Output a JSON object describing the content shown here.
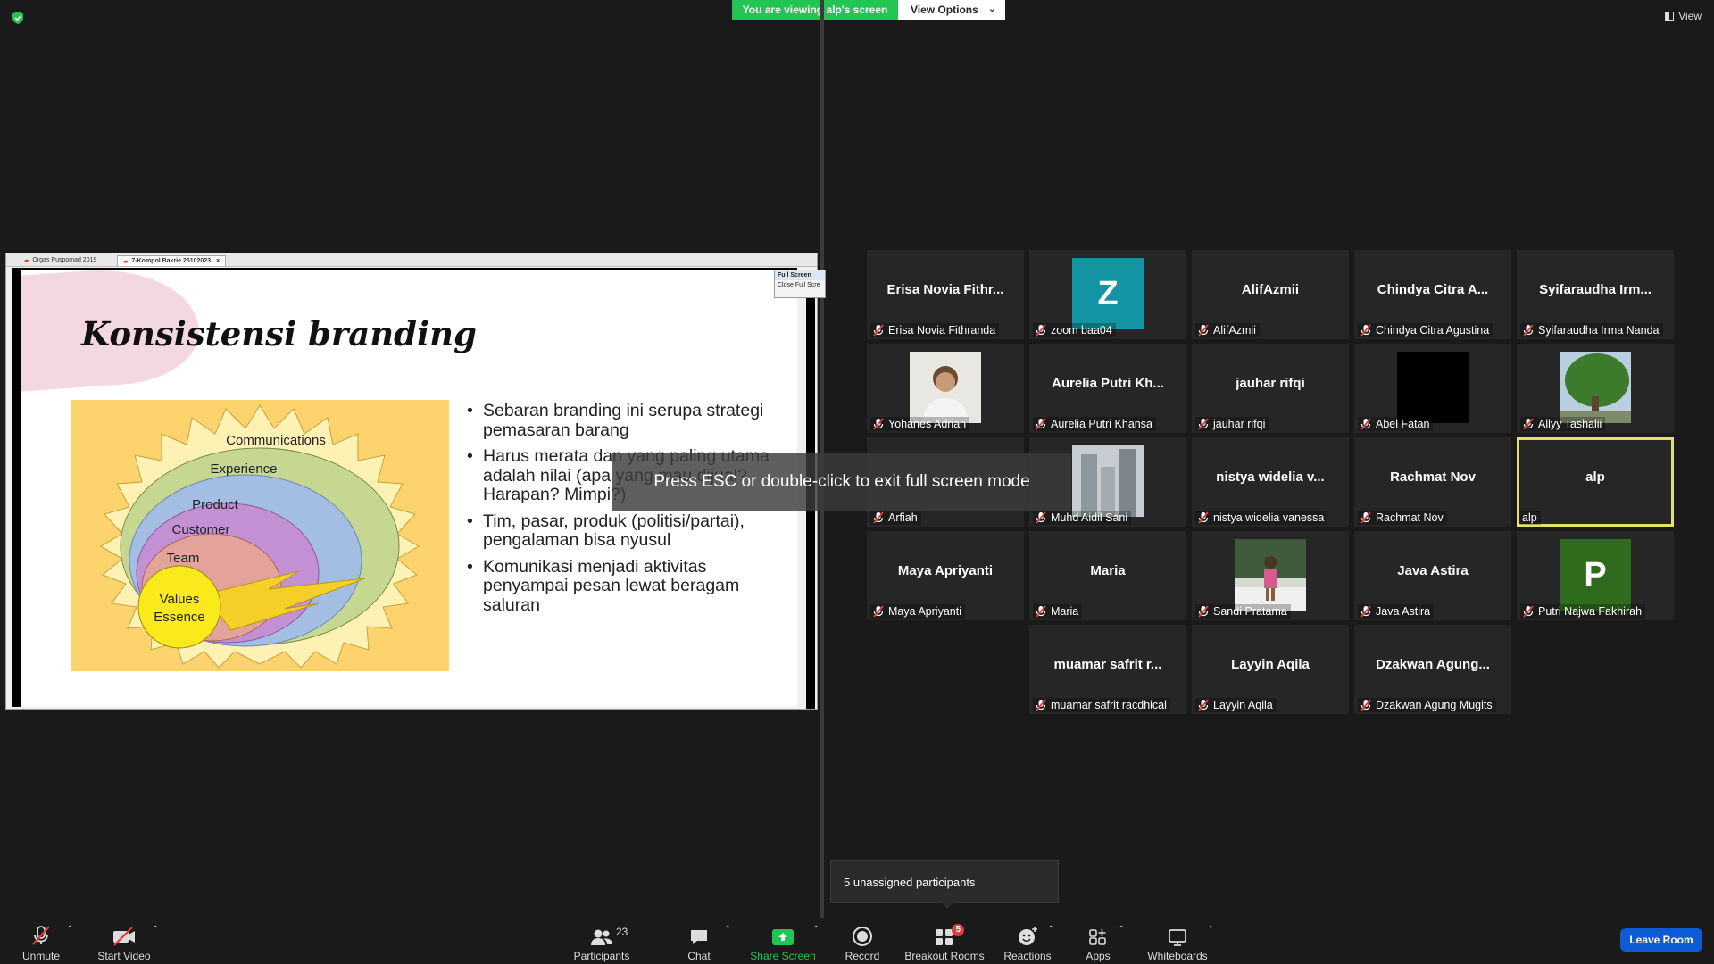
{
  "banner": {
    "viewing": "You are viewing alp's screen",
    "view_options": "View Options",
    "view": "View"
  },
  "shared_screen": {
    "tabs": [
      "Orgas Puspomad 2019",
      "7-Kompol Bakrie 25102023"
    ],
    "menu": [
      "Full Screen",
      "Close Full Scre"
    ],
    "slide": {
      "title": "Konsistensi branding",
      "diagram_labels": [
        "Communications",
        "Experience",
        "Product",
        "Customer",
        "Team",
        "Values",
        "Essence"
      ],
      "bullets": [
        "Sebaran branding ini serupa strategi pemasaran barang",
        "Harus merata dan yang paling utama adalah nilai (apa yang mau dijual? Harapan? Mimpi?)",
        "Tim, pasar, produk (politisi/partai), pengalaman bisa nyusul",
        "Komunikasi menjadi aktivitas penyampai pesan lewat beragam saluran"
      ]
    },
    "esc_message": "Press ESC or double-click to exit full screen mode"
  },
  "gallery": [
    {
      "big": "Erisa Novia Fithr...",
      "name": "Erisa Novia Fithranda"
    },
    {
      "avatar_letter": "Z",
      "avatar_color": "#1594a4",
      "name": "zoom baa04"
    },
    {
      "big": "AlifAzmii",
      "name": "AlifAzmii"
    },
    {
      "big": "Chindya Citra A...",
      "name": "Chindya Citra Agustina"
    },
    {
      "big": "Syifaraudha Irm...",
      "name": "Syifaraudha Irma Nanda"
    },
    {
      "photo": "person-photo",
      "name": "Yohanes Adrian"
    },
    {
      "big": "Aurelia Putri Kh...",
      "name": "Aurelia Putri Khansa"
    },
    {
      "big": "jauhar rifqi",
      "name": "jauhar rifqi"
    },
    {
      "photo": "black-photo",
      "name": "Abel Fatan"
    },
    {
      "photo": "tree-photo",
      "name": "Allyy Tashalii"
    },
    {
      "big": "",
      "name": "Arfiah"
    },
    {
      "photo": "building-photo",
      "name": "Muhd Aidil Sani"
    },
    {
      "big": "nistya widelia v...",
      "name": "nistya widelia vanessa"
    },
    {
      "big": "Rachmat Nov",
      "name": "Rachmat Nov"
    },
    {
      "big": "alp",
      "name": "alp",
      "active": true
    },
    {
      "big": "Maya Apriyanti",
      "name": "Maya Apriyanti"
    },
    {
      "big": "Maria",
      "name": "Maria"
    },
    {
      "photo": "child-photo",
      "name": "Sandi Pratama"
    },
    {
      "big": "Java Astira",
      "name": "Java Astira"
    },
    {
      "avatar_letter": "P",
      "avatar_color": "#2e6b1c",
      "name": "Putri Najwa Fakhirah"
    },
    {
      "big": "muamar safrit r...",
      "name": "muamar safrit racdhical"
    },
    {
      "big": "Layyin Aqila",
      "name": "Layyin Aqila"
    },
    {
      "big": "Dzakwan Agung...",
      "name": "Dzakwan Agung Mugits"
    }
  ],
  "unassigned": "5 unassigned participants",
  "toolbar": {
    "unmute": "Unmute",
    "start_video": "Start Video",
    "participants": "Participants",
    "participants_count": "23",
    "chat": "Chat",
    "share_screen": "Share Screen",
    "record": "Record",
    "breakout_rooms": "Breakout Rooms",
    "breakout_badge": "5",
    "reactions": "Reactions",
    "apps": "Apps",
    "whiteboards": "Whiteboards",
    "leave_room": "Leave Room"
  },
  "colors": {
    "share_green": "#23c552",
    "leave_blue": "#0e5bd6",
    "active_border": "#e3e06f",
    "muted_red": "#e23d3d"
  }
}
